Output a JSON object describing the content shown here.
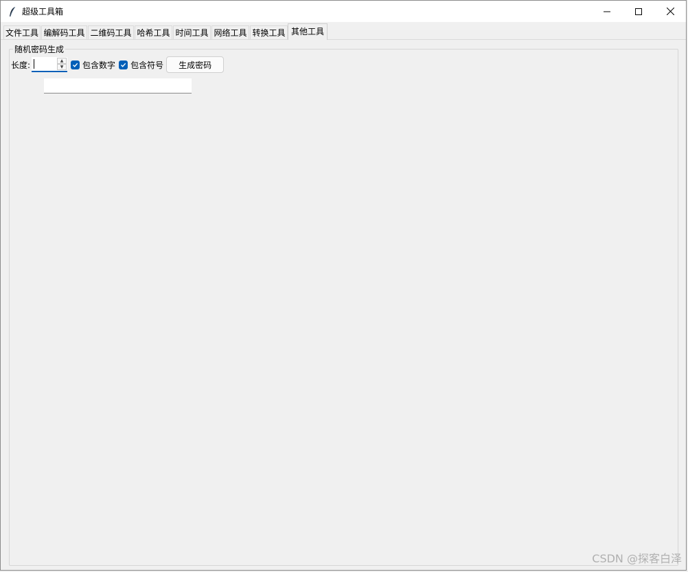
{
  "window": {
    "title": "超级工具箱"
  },
  "tabs": [
    {
      "label": "文件工具"
    },
    {
      "label": "编解码工具"
    },
    {
      "label": "二维码工具"
    },
    {
      "label": "哈希工具"
    },
    {
      "label": "时间工具"
    },
    {
      "label": "网络工具"
    },
    {
      "label": "转换工具"
    },
    {
      "label": "其他工具"
    }
  ],
  "active_tab": "其他工具",
  "password_group": {
    "title": "随机密码生成",
    "length_label": "长度:",
    "length_value": "",
    "include_digits_label": "包含数字",
    "include_digits_checked": true,
    "include_symbols_label": "包含符号",
    "include_symbols_checked": true,
    "generate_button": "生成密码",
    "output_value": ""
  },
  "watermark": "CSDN @探客白泽",
  "colors": {
    "accent": "#005fb8",
    "background": "#f0f0f0"
  }
}
